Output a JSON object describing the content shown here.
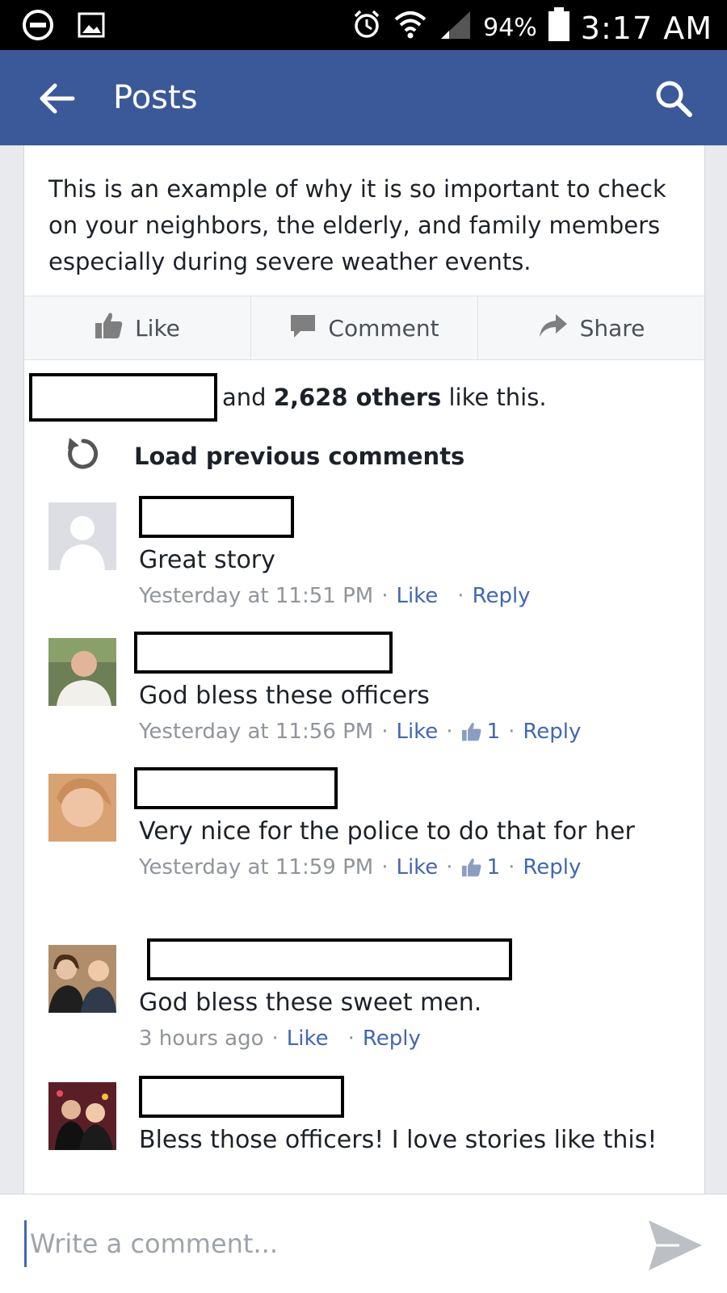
{
  "status_bar": {
    "battery_percent": "94%",
    "time": "3:17 AM"
  },
  "app_bar": {
    "title": "Posts"
  },
  "post": {
    "text": "This is an example of why it is so important to check on your neighbors, the elderly, and family members especially during severe weather events.",
    "actions": {
      "like": "Like",
      "comment": "Comment",
      "share": "Share"
    }
  },
  "likes": {
    "prefix": "and",
    "count_text": "2,628 others",
    "suffix": "like this."
  },
  "load_previous": "Load previous comments",
  "comments": [
    {
      "text": "Great story",
      "time": "Yesterday at 11:51 PM",
      "like": "Like",
      "reply": "Reply",
      "likes_count": ""
    },
    {
      "text": "God bless these officers",
      "time": "Yesterday at 11:56 PM",
      "like": "Like",
      "reply": "Reply",
      "likes_count": "1"
    },
    {
      "text": "Very nice for the police to do that for her",
      "time": "Yesterday at 11:59 PM",
      "like": "Like",
      "reply": "Reply",
      "likes_count": "1"
    },
    {
      "text": "God bless these sweet men.",
      "time": "3 hours ago",
      "like": "Like",
      "reply": "Reply",
      "likes_count": ""
    },
    {
      "text": "Bless those officers! I love stories like this!",
      "time": "",
      "like": "",
      "reply": "",
      "likes_count": ""
    }
  ],
  "composer": {
    "placeholder": "Write a comment..."
  },
  "colors": {
    "app_bar": "#3b5998",
    "link": "#4267b2",
    "meta_gray": "#90949c"
  }
}
